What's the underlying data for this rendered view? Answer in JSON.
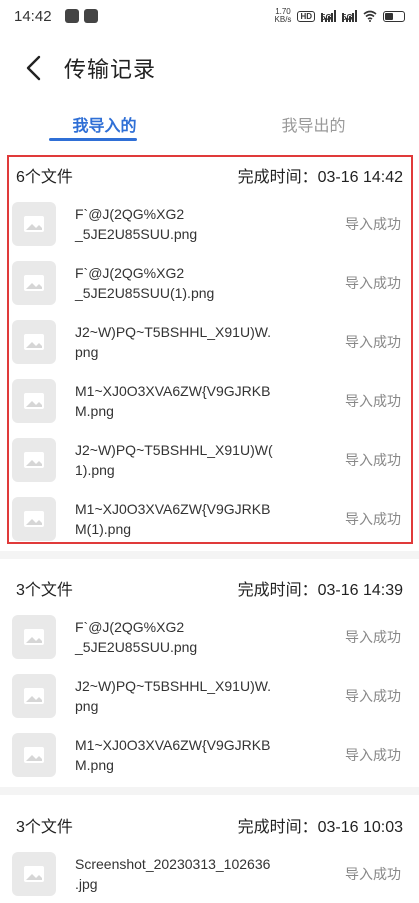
{
  "status_bar": {
    "time": "14:42",
    "speed_value": "1.70",
    "speed_unit": "KB/s",
    "hd_label": "HD",
    "sim1_label": "5G",
    "sim2_label": "5G"
  },
  "header": {
    "title": "传输记录"
  },
  "tabs": [
    {
      "label": "我导入的",
      "active": true
    },
    {
      "label": "我导出的",
      "active": false
    }
  ],
  "groups": [
    {
      "count_label": "6个文件",
      "time_label": "完成时间：",
      "time_value": "03-16 14:42",
      "files": [
        {
          "name": "F`@J(2QG%XG2\n_5JE2U85SUU.png",
          "status": "导入成功"
        },
        {
          "name": "F`@J(2QG%XG2\n_5JE2U85SUU(1).png",
          "status": "导入成功"
        },
        {
          "name": "J2~W)PQ~T5BSHHL_X91U)W.\npng",
          "status": "导入成功"
        },
        {
          "name": "M1~XJ0O3XVA6ZW{V9GJRKB\nM.png",
          "status": "导入成功"
        },
        {
          "name": "J2~W)PQ~T5BSHHL_X91U)W(\n1).png",
          "status": "导入成功"
        },
        {
          "name": "M1~XJ0O3XVA6ZW{V9GJRKB\nM(1).png",
          "status": "导入成功"
        }
      ]
    },
    {
      "count_label": "3个文件",
      "time_label": "完成时间：",
      "time_value": "03-16 14:39",
      "files": [
        {
          "name": "F`@J(2QG%XG2\n_5JE2U85SUU.png",
          "status": "导入成功"
        },
        {
          "name": "J2~W)PQ~T5BSHHL_X91U)W.\npng",
          "status": "导入成功"
        },
        {
          "name": "M1~XJ0O3XVA6ZW{V9GJRKB\nM.png",
          "status": "导入成功"
        }
      ]
    },
    {
      "count_label": "3个文件",
      "time_label": "完成时间：",
      "time_value": "03-16 10:03",
      "files": [
        {
          "name": "Screenshot_20230313_102636\n.jpg",
          "status": "导入成功"
        }
      ]
    }
  ],
  "colors": {
    "accent": "#2f6fd6",
    "highlight": "#e03a3a",
    "muted": "#888888"
  }
}
